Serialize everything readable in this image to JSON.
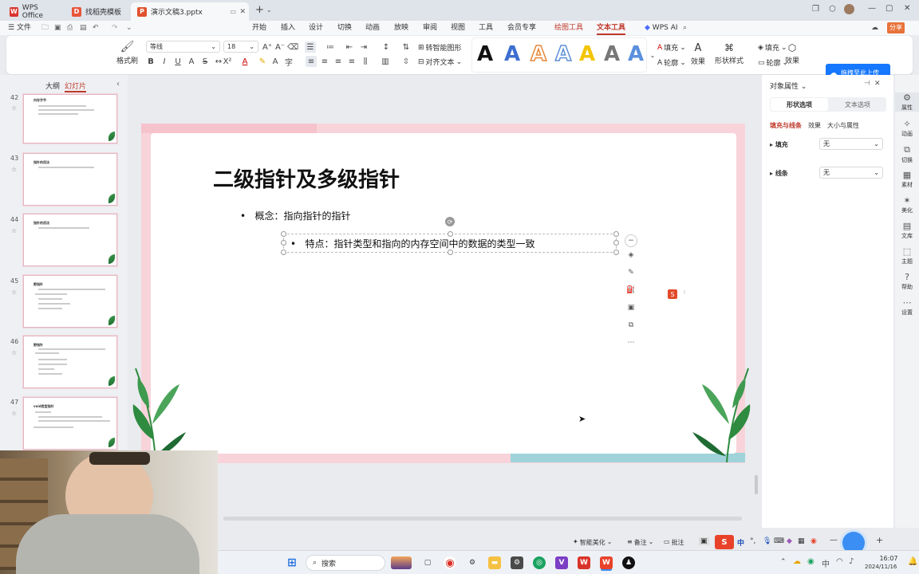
{
  "tabs": [
    {
      "label": "WPS Office"
    },
    {
      "label": "找稻壳模板"
    },
    {
      "label": "演示文稿3.pptx"
    }
  ],
  "menu": {
    "file": "文件",
    "items": [
      "开始",
      "插入",
      "设计",
      "切换",
      "动画",
      "放映",
      "审阅",
      "视图",
      "工具",
      "会员专享"
    ],
    "drawing_tool": "绘图工具",
    "text_tool": "文本工具",
    "wps_ai": "WPS AI",
    "share": "分享"
  },
  "ribbon": {
    "format_painter": "格式刷",
    "font_name": "等线",
    "font_size": "18",
    "smart_shape": "转智能图形",
    "align_text": "对齐文本",
    "fill": "填充",
    "outline": "轮廓",
    "effect": "效果",
    "shape_style": "形状样式",
    "fill2": "填充",
    "outline2": "轮廓",
    "effect2": "效果",
    "upload_banner": "拖拽至此上传"
  },
  "left_panel": {
    "tab_outline": "大纲",
    "tab_slides": "幻灯片",
    "thumbs": [
      {
        "num": "42",
        "title": "内存字节"
      },
      {
        "num": "43",
        "title": "指针的用法"
      },
      {
        "num": "44",
        "title": "指针的用法"
      },
      {
        "num": "45",
        "title": "野指针"
      },
      {
        "num": "46",
        "title": "野指针"
      },
      {
        "num": "47",
        "title": "void类型指针"
      }
    ]
  },
  "slide": {
    "title": "二级指针及多级指针",
    "bullet1": "概念：指向指针的指针",
    "bullet2": "特点：指针类型和指向的内存空间中的数据的类型一致"
  },
  "right_panel": {
    "title": "对象属性",
    "tab_shape": "形状选项",
    "tab_text": "文本选项",
    "sub_fill_line": "填充与线条",
    "sub_effect": "效果",
    "sub_size": "大小与属性",
    "fill_label": "填充",
    "fill_value": "无",
    "line_label": "线条",
    "line_value": "无"
  },
  "right_sidebar": [
    "属性",
    "动画",
    "切换",
    "素材",
    "美化",
    "文库",
    "主题",
    "帮助",
    "设置"
  ],
  "status": {
    "smart_beautify": "智能美化",
    "notes": "备注",
    "comments": "批注",
    "ime": "中"
  },
  "taskbar": {
    "search": "搜索",
    "time": "16:07",
    "date": "2024/11/16"
  },
  "colors": {
    "accent_red": "#c0392b",
    "slide_border": "#f8d3da",
    "leaf_green": "#2e8b3f",
    "upload_blue": "#1677ff"
  }
}
